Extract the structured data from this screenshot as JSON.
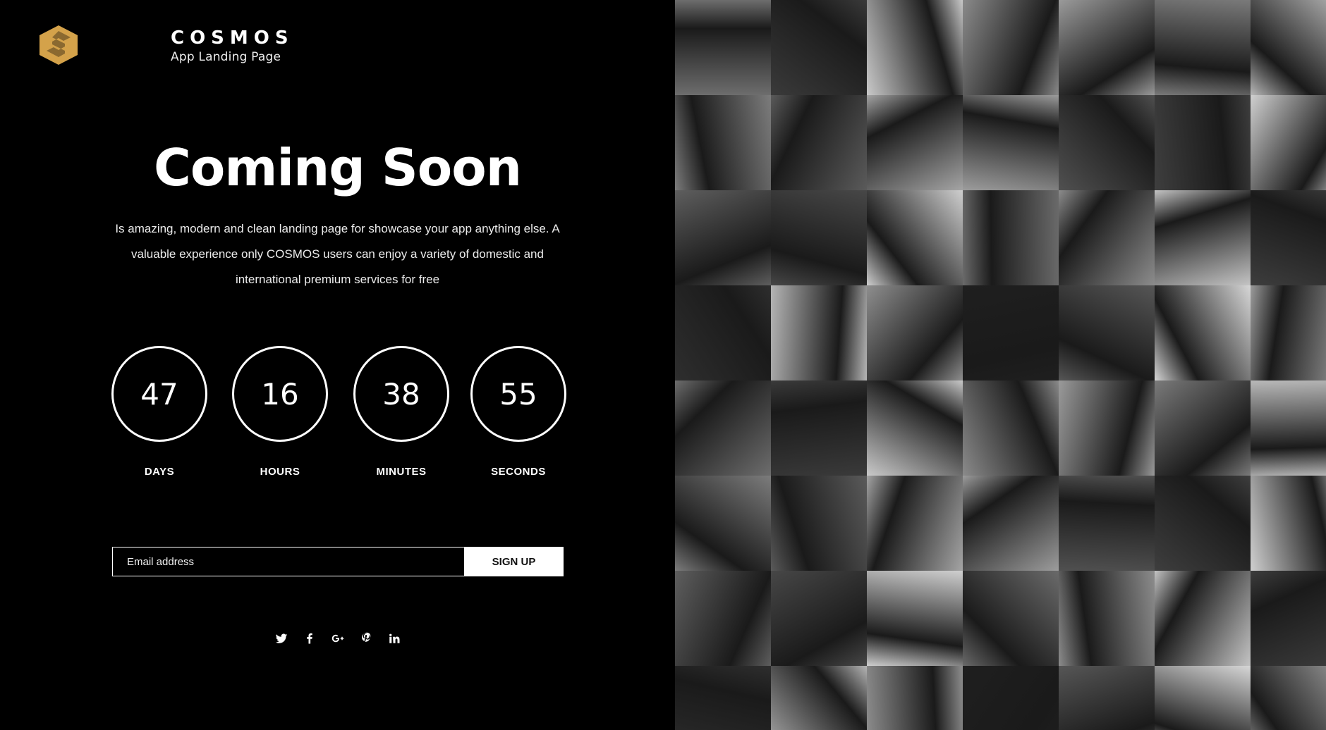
{
  "brand": {
    "name": "COSMOS",
    "subtitle": "App Landing Page",
    "logo_color": "#d4a24a",
    "logo_icon": "hexagon-s-logo"
  },
  "hero": {
    "title": "Coming Soon",
    "description": "Is amazing, modern and clean landing page for showcase your app anything else. A valuable experience only COSMOS users can enjoy a variety of domestic and international premium services for free"
  },
  "countdown": [
    {
      "value": "47",
      "label": "DAYS"
    },
    {
      "value": "16",
      "label": "HOURS"
    },
    {
      "value": "38",
      "label": "MINUTES"
    },
    {
      "value": "55",
      "label": "SECONDS"
    }
  ],
  "subscribe": {
    "placeholder": "Email address",
    "button_label": "SIGN UP"
  },
  "social": [
    "twitter-icon",
    "facebook-icon",
    "google-plus-icon",
    "pinterest-icon",
    "linkedin-icon"
  ],
  "gallery": {
    "style": "grayscale photo collage",
    "tile_shades": [
      "#6d6d6d",
      "#3a3a3a",
      "#c9c9c9",
      "#8a8a8a",
      "#9a9a9a",
      "#7a7a7a",
      "#b9b9b9",
      "#7c7c7c",
      "#5a5a5a",
      "#a4a4a4",
      "#9c9c9c",
      "#505050",
      "#3e3e3e",
      "#d0d0d0",
      "#5e5e5e",
      "#474747",
      "#cfcfcf",
      "#6a6a6a",
      "#8c8c8c",
      "#c4c4c4",
      "#3d3d3d",
      "#2e2e2e",
      "#b5b5b5",
      "#8e8e8e",
      "#1f1f1f",
      "#565656",
      "#d7d7d7",
      "#9b9b9b"
    ]
  }
}
